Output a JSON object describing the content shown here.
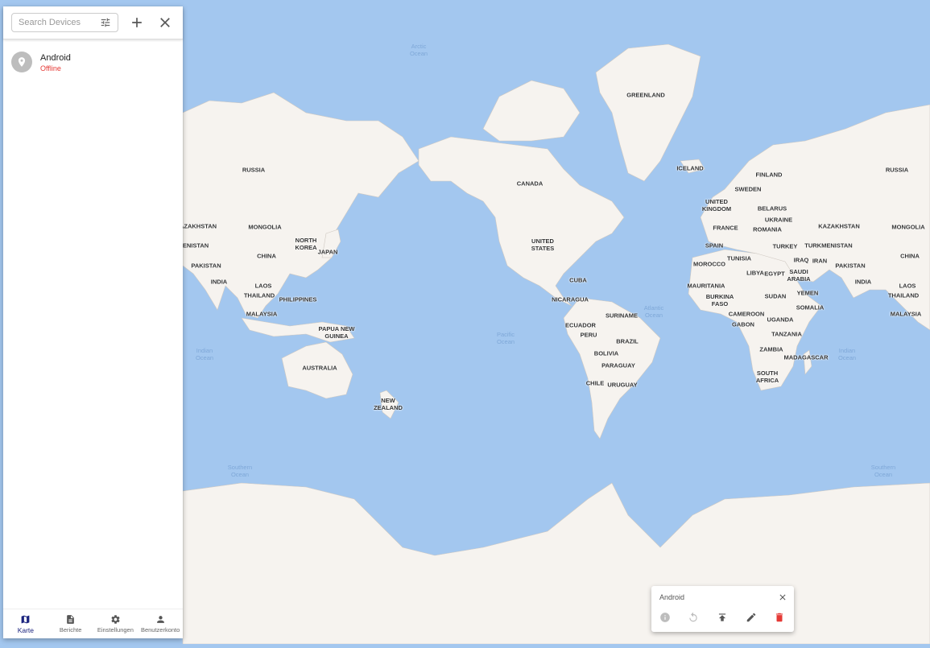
{
  "drawer": {
    "search_placeholder": "Search Devices",
    "devices": [
      {
        "name": "Android",
        "status": "Offline"
      }
    ]
  },
  "nav": {
    "items": [
      {
        "label": "Karte",
        "icon": "map-icon",
        "active": true
      },
      {
        "label": "Berichte",
        "icon": "description-icon",
        "active": false
      },
      {
        "label": "Einstellungen",
        "icon": "gear-icon",
        "active": false
      },
      {
        "label": "Benutzerkonto",
        "icon": "person-icon",
        "active": false
      }
    ]
  },
  "status_card": {
    "title": "Android",
    "actions": [
      "info-icon",
      "replay-icon",
      "publish-icon",
      "edit-icon",
      "delete-icon"
    ]
  },
  "map": {
    "countries": {
      "greenland": "GREENLAND",
      "russia_w": "RUSSIA",
      "russia_e": "RUSSIA",
      "canada": "CANADA",
      "iceland": "ICELAND",
      "finland": "FINLAND",
      "sweden": "SWEDEN",
      "uk": "UNITED\nKINGDOM",
      "belarus": "BELARUS",
      "ukraine": "UKRAINE",
      "france": "FRANCE",
      "romania": "ROMANIA",
      "kazakhstan_w": "AZAKHSTAN",
      "kazakhstan_e": "KAZAKHSTAN",
      "mongolia_w": "MONGOLIA",
      "mongolia_e": "MONGOLIA",
      "turkmenistan": "TURKMENISTAN",
      "north_korea": "NORTH\nKOREA",
      "japan": "JAPAN",
      "china_w": "CHINA",
      "china_e": "CHINA",
      "enistan": "ENISTAN",
      "pakistan_w": "PAKISTAN",
      "pakistan_e": "PAKISTAN",
      "india_w": "INDIA",
      "india_e": "INDIA",
      "laos_w": "LAOS",
      "laos_e": "LAOS",
      "thailand_w": "THAILAND",
      "thailand_e": "THAILAND",
      "philippines": "PHILIPPINES",
      "malaysia_w": "MALAYSIA",
      "malaysia_e": "MALAYSIA",
      "png": "PAPUA NEW\nGUINEA",
      "australia": "AUSTRALIA",
      "nz": "NEW\nZEALAND",
      "us": "UNITED\nSTATES",
      "cuba": "CUBA",
      "nicaragua": "NICARAGUA",
      "suriname": "SURINAME",
      "ecuador": "ECUADOR",
      "peru": "PERU",
      "brazil": "BRAZIL",
      "bolivia": "BOLIVIA",
      "paraguay": "PARAGUAY",
      "chile": "CHILE",
      "uruguay": "URUGUAY",
      "spain": "SPAIN",
      "turkey": "TURKEY",
      "iraq": "IRAQ",
      "iran": "IRAN",
      "morocco": "MOROCCO",
      "tunisia": "TUNISIA",
      "libya": "LIBYA",
      "egypt": "EGYPT",
      "saudi": "SAUDI\nARABIA",
      "mauritania": "MAURITANIA",
      "burkina": "BURKINA\nFASO",
      "sudan": "SUDAN",
      "yemen": "YEMEN",
      "somalia": "SOMALIA",
      "cameroon": "CAMEROON",
      "gabon": "GABON",
      "uganda": "UGANDA",
      "tanzania": "TANZANIA",
      "zambia": "ZAMBIA",
      "madagascar": "MADAGASCAR",
      "south_africa": "SOUTH\nAFRICA"
    },
    "oceans": {
      "arctic": "Arctic\nOcean",
      "pacific": "Pacific\nOcean",
      "atlantic": "Atlantic\nOcean",
      "indian_w": "Indian\nOcean",
      "indian_e": "Indian\nOcean",
      "southern_w": "Southern\nOcean",
      "southern_e": "Southern\nOcean"
    }
  }
}
